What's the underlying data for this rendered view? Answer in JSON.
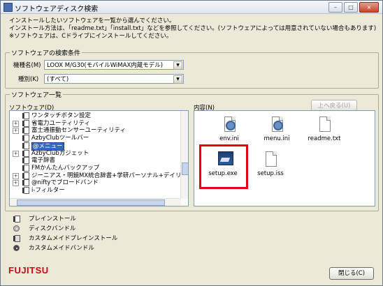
{
  "window": {
    "title": "ソフトウェアディスク検索",
    "controls": {
      "minimize": "–",
      "maximize": "□",
      "close": "×"
    }
  },
  "instructions": [
    "インストールしたいソフトウェアを一覧から選んでください。",
    "インストール方法は、「readme.txt」「install.txt」などを参照してください。(ソフトウェアによっては用意されていない場合もあります)",
    "※ソフトウェアは、Cドライブにインストールしてください。"
  ],
  "search_conditions": {
    "legend": "ソフトウェアの検索条件",
    "model_label": "機種名(M)",
    "model_value": "LOOX M/G30(モバイルWiMAX内蔵モデル)",
    "type_label": "種別(K)",
    "type_value": "(すべて)"
  },
  "software_list": {
    "legend": "ソフトウェア一覧",
    "tree_label": "ソフトウェア(D)",
    "items": [
      {
        "label": "ワンタッチボタン設定",
        "expander": ""
      },
      {
        "label": "省電力ユーティリティ",
        "expander": "+"
      },
      {
        "label": "富士通振動センサーユーティリティ",
        "expander": "+"
      },
      {
        "label": "AzbyClubツールバー",
        "expander": ""
      },
      {
        "label": "@メニュー",
        "expander": "",
        "selected": true
      },
      {
        "label": "AzbyClubガジェット",
        "expander": "+"
      },
      {
        "label": "電子辞書",
        "expander": ""
      },
      {
        "label": "FMかんたんバックアップ",
        "expander": ""
      },
      {
        "label": "ジーニアス・明鏡MX統合辞書+学研パーソナル+デイリー",
        "expander": "+"
      },
      {
        "label": "@niftyでブロードバンド",
        "expander": "+"
      },
      {
        "label": "i-フィルター",
        "expander": ""
      }
    ],
    "content_label": "内容(N)",
    "up_button": "上へ戻る(U)",
    "files": [
      {
        "name": "env.ini",
        "icon": "settings-file-icon"
      },
      {
        "name": "menu.ini",
        "icon": "settings-file-icon"
      },
      {
        "name": "readme.txt",
        "icon": "text-file-icon"
      },
      {
        "name": "setup.exe",
        "icon": "setup-exe-icon"
      },
      {
        "name": "setup.iss",
        "icon": "blank-file-icon"
      }
    ],
    "highlight_color": "#e30613"
  },
  "legend_items": [
    {
      "label": "プレインストール",
      "icon": "preinstall-icon"
    },
    {
      "label": "ディスクバンドル",
      "icon": "disc-bundle-icon"
    },
    {
      "label": "カスタムメイドプレインストール",
      "icon": "custom-preinstall-icon"
    },
    {
      "label": "カスタムメイドバンドル",
      "icon": "custom-bundle-icon"
    }
  ],
  "footer": {
    "logo": "FUJITSU",
    "close_button": "閉じる(C)"
  },
  "colors": {
    "selection": "#316ac5",
    "brand": "#d7000f"
  }
}
